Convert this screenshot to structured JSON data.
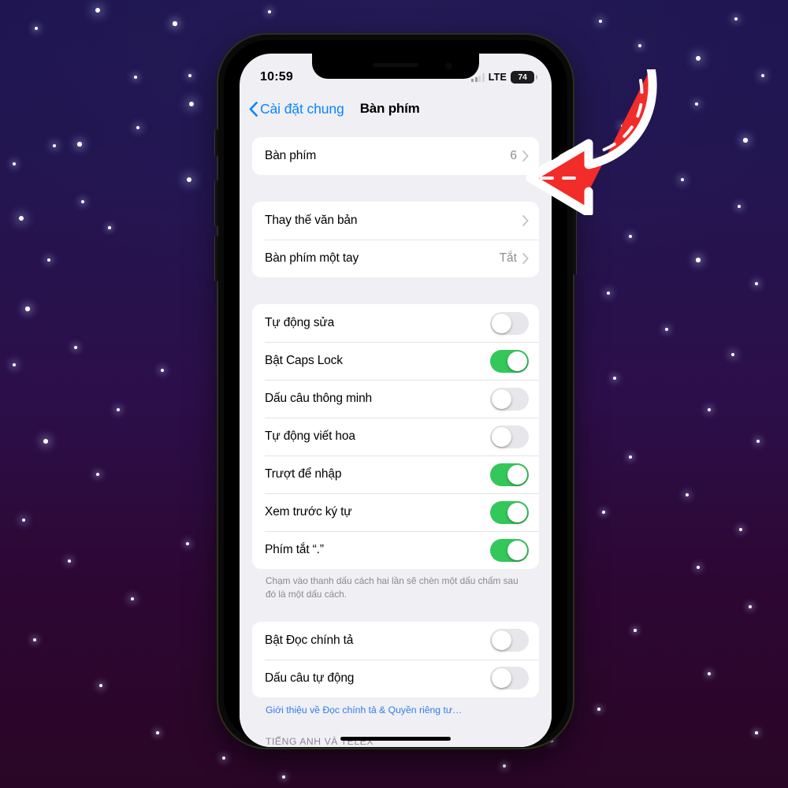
{
  "background": {
    "top_color": "#1d1550",
    "bottom_color": "#2a0626",
    "star_color": "#ffffff"
  },
  "device": {
    "frame_color": "#0a0a0a",
    "notch": {
      "speaker_icon": "speaker-slot",
      "camera_icon": "front-camera"
    },
    "buttons": [
      "silent-switch",
      "volume-up",
      "volume-down",
      "power"
    ]
  },
  "status_bar": {
    "time": "10:59",
    "signal_icon": "cellular-bars",
    "network": "LTE",
    "battery_level": "74"
  },
  "nav_bar": {
    "back_icon": "chevron-left-icon",
    "back_label": "Cài đặt chung",
    "title": "Bàn phím"
  },
  "sections": [
    {
      "name": "keyboards",
      "rows": [
        {
          "label": "Bàn phím",
          "value": "6",
          "type": "disclosure",
          "chevron_icon": "chevron-right-icon"
        }
      ]
    },
    {
      "name": "text-options",
      "rows": [
        {
          "label": "Thay thế văn bản",
          "value": "",
          "type": "disclosure",
          "chevron_icon": "chevron-right-icon"
        },
        {
          "label": "Bàn phím một tay",
          "value": "Tắt",
          "type": "disclosure",
          "chevron_icon": "chevron-right-icon"
        }
      ]
    },
    {
      "name": "typing-toggles",
      "rows": [
        {
          "label": "Tự động sửa",
          "type": "toggle",
          "on": false
        },
        {
          "label": "Bật Caps Lock",
          "type": "toggle",
          "on": true
        },
        {
          "label": "Dấu câu thông minh",
          "type": "toggle",
          "on": false
        },
        {
          "label": "Tự động viết hoa",
          "type": "toggle",
          "on": false
        },
        {
          "label": "Trượt để nhập",
          "type": "toggle",
          "on": true
        },
        {
          "label": "Xem trước ký tự",
          "type": "toggle",
          "on": true
        },
        {
          "label": "Phím tắt “.”",
          "type": "toggle",
          "on": true
        }
      ],
      "footnote": "Chạm vào thanh dấu cách hai lần sẽ chèn một dấu chấm sau đó là một dấu cách."
    },
    {
      "name": "dictation",
      "rows": [
        {
          "label": "Bật Đọc chính tả",
          "type": "toggle",
          "on": false
        },
        {
          "label": "Dấu câu tự động",
          "type": "toggle",
          "on": false
        }
      ],
      "link": "Giới thiệu về Đọc chính tả & Quyền riêng tư…"
    },
    {
      "name": "english-telex",
      "header": "TIẾNG ANH VÀ TELEX",
      "rows": [
        {
          "label": "",
          "type": "toggle",
          "on": true
        }
      ]
    }
  ],
  "home_indicator": "home-indicator",
  "annotation": {
    "arrow_icon": "curved-arrow-pointing-left",
    "arrow_fill": "#F22C29",
    "arrow_outline": "#ffffff"
  },
  "colors": {
    "accent_blue": "#0A84FF",
    "toggle_green": "#34C759",
    "screen_bg": "#F0EFF4",
    "card_bg": "#ffffff",
    "secondary_text": "#8E8E93"
  }
}
